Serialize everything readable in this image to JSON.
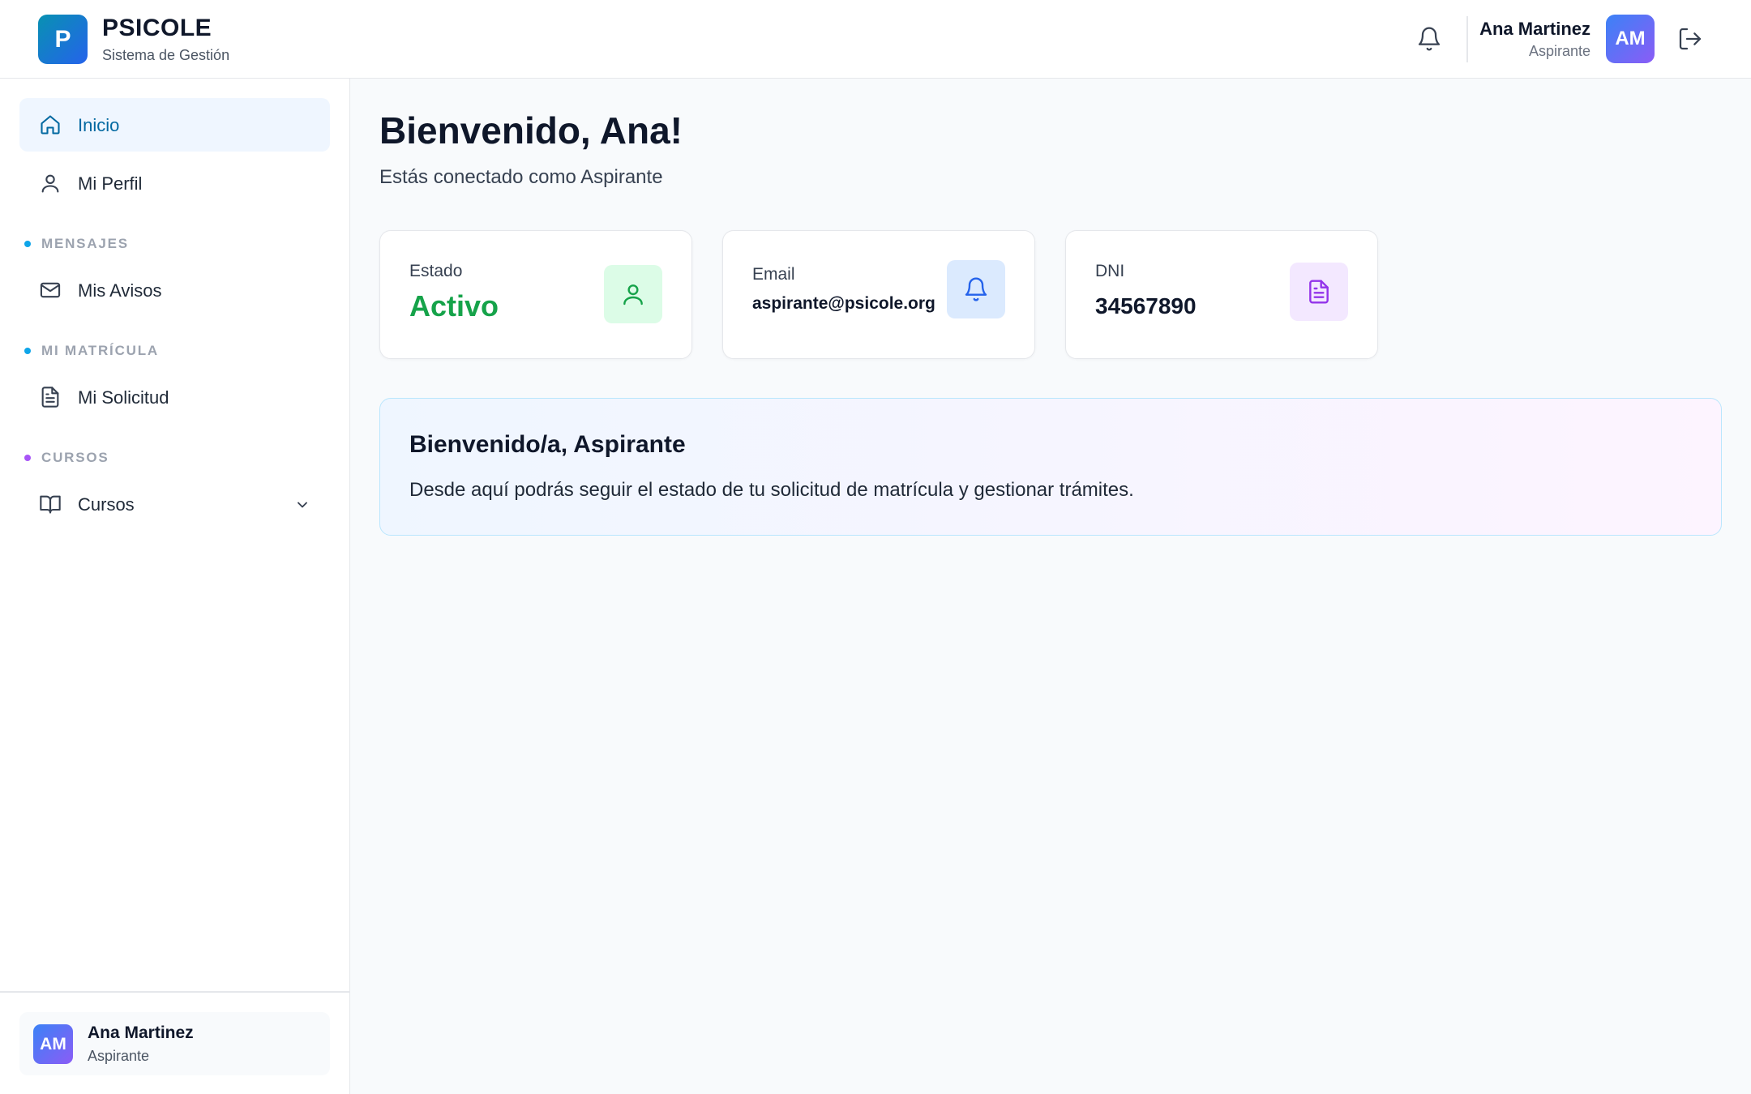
{
  "app": {
    "logo_letter": "P",
    "name": "PSICOLE",
    "subtitle": "Sistema de Gestión"
  },
  "header": {
    "user_name": "Ana Martinez",
    "user_role": "Aspirante",
    "avatar_initials": "AM"
  },
  "sidebar": {
    "items": [
      {
        "label": "Inicio"
      },
      {
        "label": "Mi Perfil"
      }
    ],
    "sections": [
      {
        "label": "MENSAJES",
        "dot_color": "#0ea5e9",
        "items": [
          {
            "label": "Mis Avisos"
          }
        ]
      },
      {
        "label": "MI MATRÍCULA",
        "dot_color": "#0ea5e9",
        "items": [
          {
            "label": "Mi Solicitud"
          }
        ]
      },
      {
        "label": "CURSOS",
        "dot_color": "#a855f7",
        "items": [
          {
            "label": "Cursos"
          }
        ]
      }
    ],
    "footer": {
      "avatar_initials": "AM",
      "name": "Ana Martinez",
      "role": "Aspirante"
    }
  },
  "main": {
    "title": "Bienvenido, Ana!",
    "subtitle": "Estás conectado como Aspirante",
    "cards": [
      {
        "label": "Estado",
        "value": "Activo",
        "value_color": "#16a34a",
        "icon_bg": "#dcfce7"
      },
      {
        "label": "Email",
        "value": "aspirante@psicole.org",
        "icon_bg": "#dbeafe"
      },
      {
        "label": "DNI",
        "value": "34567890",
        "icon_bg": "#f3e8ff"
      }
    ],
    "welcome": {
      "title": "Bienvenido/a, Aspirante",
      "text": "Desde aquí podrás seguir el estado de tu solicitud de matrícula y gestionar trámites."
    }
  },
  "colors": {
    "accent": "#0369a1",
    "active_bg": "#eff6ff",
    "success": "#16a34a"
  }
}
